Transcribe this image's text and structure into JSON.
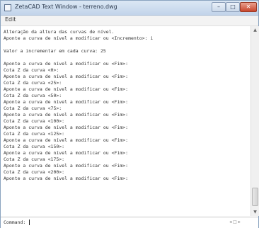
{
  "window": {
    "title": "ZetaCAD Text Window - terreno.dwg",
    "minimize_label": "–",
    "maximize_label": "□",
    "close_label": "✕"
  },
  "menu": {
    "edit": "Edit"
  },
  "lines": [
    "Alteração da altura das curvas de nível.",
    "Aponte a curva de nível a modificar ou <Incremento>: i",
    "",
    "Valor a incrementar em cada curva: 25",
    "",
    "Aponte a curva de nível a modificar ou <Fim>:",
    "Cota Z da curva <0>:",
    "Aponte a curva de nível a modificar ou <Fim>:",
    "Cota Z da curva <25>:",
    "Aponte a curva de nível a modificar ou <Fim>:",
    "Cota Z da curva <50>:",
    "Aponte a curva de nível a modificar ou <Fim>:",
    "Cota Z da curva <75>:",
    "Aponte a curva de nível a modificar ou <Fim>:",
    "Cota Z da curva <100>:",
    "Aponte a curva de nível a modificar ou <Fim>:",
    "Cota Z da curva <125>:",
    "Aponte a curva de nível a modificar ou <Fim>:",
    "Cota Z da curva <150>:",
    "Aponte a curva de nível a modificar ou <Fim>:",
    "Cota Z da curva <175>:",
    "Aponte a curva de nível a modificar ou <Fim>:",
    "Cota Z da curva <200>:",
    "Aponte a curva de nível a modificar ou <Fim>:"
  ],
  "command": {
    "label": "Command:",
    "value": ""
  },
  "scrollbar": {
    "up": "▲",
    "down": "▼"
  },
  "status": {
    "text": "◂ □ ▸"
  }
}
